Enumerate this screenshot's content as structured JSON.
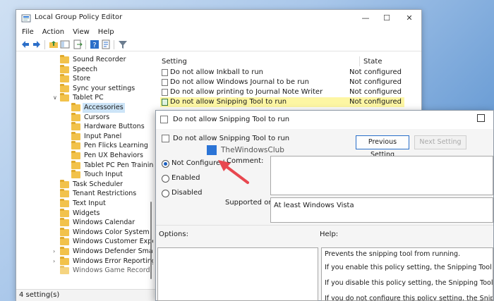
{
  "window": {
    "title": "Local Group Policy Editor",
    "controls": {
      "minimize": "—",
      "maximize": "☐",
      "close": "✕"
    }
  },
  "menu": [
    "File",
    "Action",
    "View",
    "Help"
  ],
  "toolbar_icons": [
    "back-arrow-icon",
    "forward-arrow-icon",
    "folder-up-icon",
    "show-hide-tree-icon",
    "export-list-icon",
    "help-icon",
    "properties-icon",
    "filter-icon"
  ],
  "tree": [
    {
      "label": "Sound Recorder",
      "level": 2
    },
    {
      "label": "Speech",
      "level": 2
    },
    {
      "label": "Store",
      "level": 2
    },
    {
      "label": "Sync your settings",
      "level": 2
    },
    {
      "label": "Tablet PC",
      "level": 2,
      "expanded": true
    },
    {
      "label": "Accessories",
      "level": 3,
      "selected": true
    },
    {
      "label": "Cursors",
      "level": 3
    },
    {
      "label": "Hardware Buttons",
      "level": 3
    },
    {
      "label": "Input Panel",
      "level": 3
    },
    {
      "label": "Pen Flicks Learning",
      "level": 3
    },
    {
      "label": "Pen UX Behaviors",
      "level": 3
    },
    {
      "label": "Tablet PC Pen Training",
      "level": 3
    },
    {
      "label": "Touch Input",
      "level": 3
    },
    {
      "label": "Task Scheduler",
      "level": 2
    },
    {
      "label": "Tenant Restrictions",
      "level": 2
    },
    {
      "label": "Text Input",
      "level": 2
    },
    {
      "label": "Widgets",
      "level": 2
    },
    {
      "label": "Windows Calendar",
      "level": 2
    },
    {
      "label": "Windows Color System",
      "level": 2
    },
    {
      "label": "Windows Customer Experi",
      "level": 2
    },
    {
      "label": "Windows Defender SmartS",
      "level": 2,
      "collapsed": true
    },
    {
      "label": "Windows Error Reporting",
      "level": 2,
      "collapsed": true
    },
    {
      "label": "Windows Game Recordi",
      "level": 2
    }
  ],
  "list": {
    "headers": {
      "setting": "Setting",
      "state": "State"
    },
    "rows": [
      {
        "setting": "Do not allow Inkball to run",
        "state": "Not configured"
      },
      {
        "setting": "Do not allow Windows Journal to be run",
        "state": "Not configured"
      },
      {
        "setting": "Do not allow printing to Journal Note Writer",
        "state": "Not configured"
      },
      {
        "setting": "Do not allow Snipping Tool to run",
        "state": "Not configured",
        "highlighted": true
      }
    ]
  },
  "status_text": "4 setting(s)",
  "dialog": {
    "title": "Do not allow Snipping Tool to run",
    "heading": "Do not allow Snipping Tool to run",
    "prev_button": "Previous Setting",
    "next_button": "Next Setting",
    "options": {
      "not_configured": "Not Configured",
      "enabled": "Enabled",
      "disabled": "Disabled"
    },
    "selected_option": "not_configured",
    "comment_label": "Comment:",
    "supported_label": "Supported on:",
    "supported_value": "At least Windows Vista",
    "options_label": "Options:",
    "help_label": "Help:",
    "help_lines": [
      "Prevents the snipping tool from running.",
      "If you enable this policy setting, the Snipping Tool will not run.",
      "If you disable this policy setting, the Snipping Tool will run.",
      "If you do not configure this policy setting, the Snipping Tool"
    ]
  },
  "watermark": "TheWindowsClub",
  "annotation_arrow_color": "#e8474f",
  "accent_highlight": "#fdf6a3"
}
